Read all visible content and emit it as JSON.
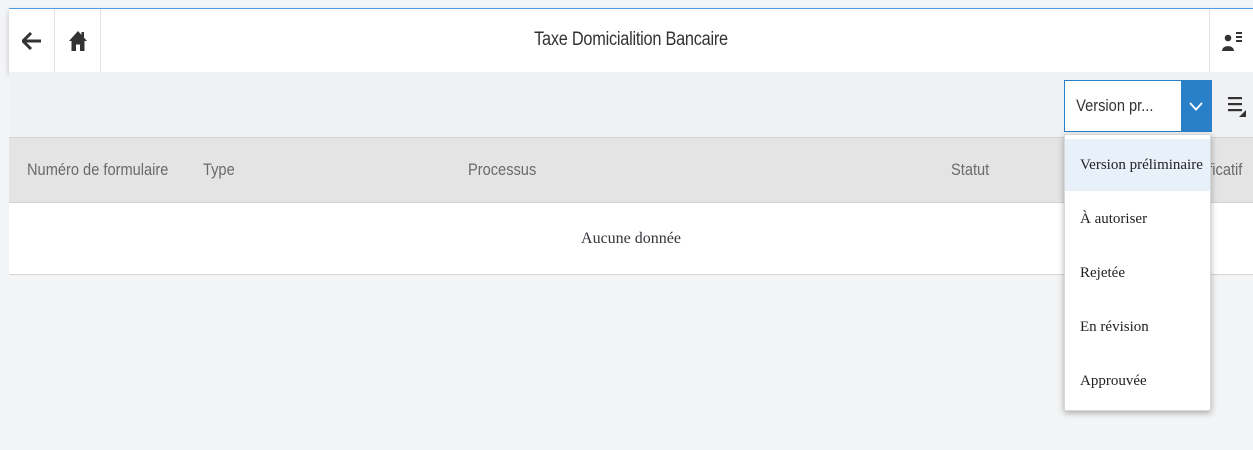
{
  "header": {
    "title": "Taxe Domicialition Bancaire",
    "back_icon": "arrow-left-icon",
    "home_icon": "home-icon",
    "user_icon": "user-menu-icon"
  },
  "toolbar": {
    "status_select": {
      "value": "Version pr...",
      "options": [
        "Version préliminaire",
        "À autoriser",
        "Rejetée",
        "En révision",
        "Approuvée"
      ],
      "selected_index": 0
    },
    "settings_icon": "list-settings-icon"
  },
  "table": {
    "columns": [
      "Numéro de formulaire",
      "Type",
      "Processus",
      "Statut",
      "ificatif"
    ],
    "empty_text": "Aucune donnée"
  },
  "colors": {
    "accent": "#2a7fc9",
    "header_border": "#4d9de0",
    "selected_option_bg": "#e8f1fa"
  }
}
